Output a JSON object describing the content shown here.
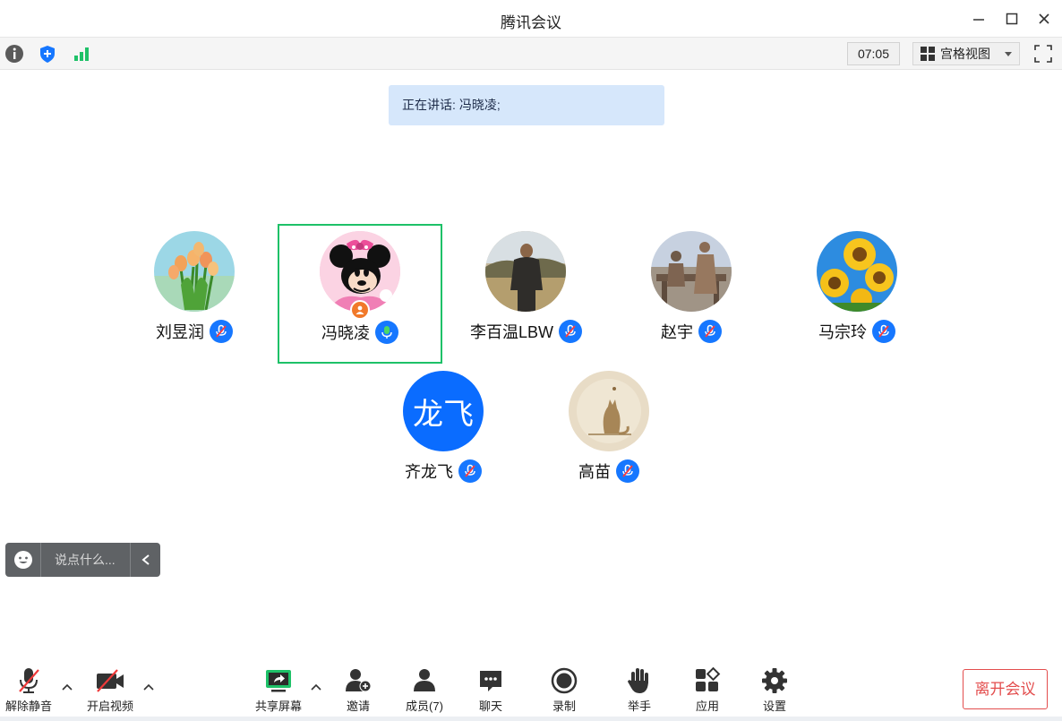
{
  "window": {
    "title": "腾讯会议"
  },
  "toolbar": {
    "timer": "07:05",
    "view_label": "宫格视图"
  },
  "banner": {
    "prefix": "正在讲话:",
    "speaker": "冯晓凌;"
  },
  "participants": [
    {
      "name": "刘昱润",
      "mic": "muted",
      "avatar": "tulips"
    },
    {
      "name": "冯晓凌",
      "mic": "speaking",
      "avatar": "minnie",
      "host": true,
      "active": true
    },
    {
      "name": "李百温LBW",
      "mic": "muted",
      "avatar": "man-standing"
    },
    {
      "name": "赵宇",
      "mic": "muted",
      "avatar": "statues"
    },
    {
      "name": "马宗玲",
      "mic": "muted",
      "avatar": "sunflowers"
    },
    {
      "name": "齐龙飞",
      "mic": "muted",
      "avatar": "letters",
      "avatar_text": "龙飞"
    },
    {
      "name": "高苗",
      "mic": "muted",
      "avatar": "cat-sketch"
    }
  ],
  "chat": {
    "placeholder": "说点什么..."
  },
  "bottombar": {
    "unmute": "解除静音",
    "start_video": "开启视频",
    "share_screen": "共享屏幕",
    "invite": "邀请",
    "members": "成员(7)",
    "chat": "聊天",
    "record": "录制",
    "raise_hand": "举手",
    "apps": "应用",
    "settings": "设置",
    "leave": "离开会议"
  },
  "colors": {
    "accent": "#1677ff",
    "active_border": "#1ec168",
    "banner_bg": "#d6e7fb",
    "leave_red": "#e34d4d"
  }
}
